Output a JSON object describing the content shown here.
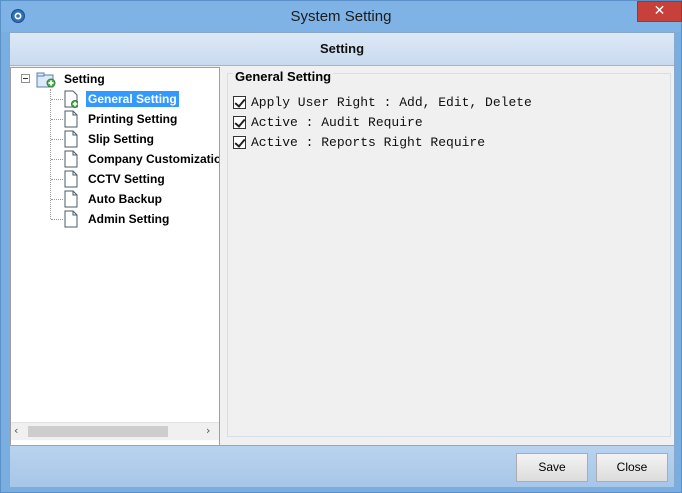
{
  "window": {
    "title": "System Setting",
    "close_glyph": "✕",
    "app_icon": "gear-icon"
  },
  "header": {
    "title": "Setting"
  },
  "tree": {
    "root_label": "Setting",
    "items": [
      {
        "label": "General Setting",
        "selected": true
      },
      {
        "label": "Printing Setting",
        "selected": false
      },
      {
        "label": "Slip Setting",
        "selected": false
      },
      {
        "label": "Company Customization",
        "selected": false
      },
      {
        "label": "CCTV Setting",
        "selected": false
      },
      {
        "label": "Auto Backup",
        "selected": false
      },
      {
        "label": "Admin Setting",
        "selected": false
      }
    ],
    "scroll_left_glyph": "‹",
    "scroll_right_glyph": "›"
  },
  "general": {
    "group_title": "General Setting",
    "options": [
      {
        "label": "Apply User Right : Add, Edit, Delete",
        "checked": true
      },
      {
        "label": "Active : Audit Require",
        "checked": true
      },
      {
        "label": "Active : Reports Right Require",
        "checked": true
      }
    ]
  },
  "footer": {
    "save_label": "Save",
    "close_label": "Close"
  },
  "colors": {
    "titlebar": "#7fb3e6",
    "selected_item": "#3399ff",
    "close_button": "#c7413a"
  }
}
